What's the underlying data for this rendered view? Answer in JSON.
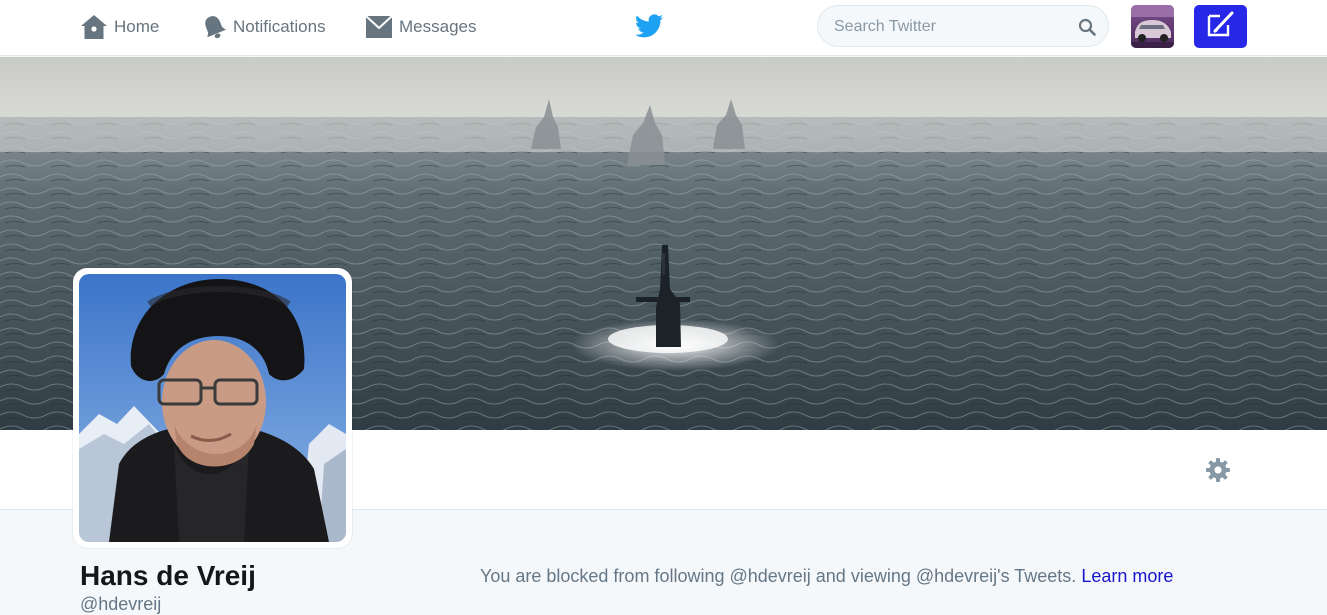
{
  "nav": {
    "home_label": "Home",
    "notifications_label": "Notifications",
    "messages_label": "Messages",
    "search_placeholder": "Search Twitter"
  },
  "profile": {
    "name": "Hans de Vreij",
    "handle": "@hdevreij",
    "blocked_text": "You are blocked from following @hdevreij and viewing @hdevreij's Tweets.",
    "learn_more_label": "Learn more"
  },
  "colors": {
    "brand_blue": "#1da1f2",
    "compose_button": "#2727e8",
    "link": "#1515cc",
    "muted_text": "#657786"
  },
  "icons": {
    "home": "home-icon",
    "notifications": "bell-icon",
    "messages": "envelope-icon",
    "logo": "twitter-bird-icon",
    "search": "search-icon",
    "compose": "compose-icon",
    "settings": "gear-icon"
  }
}
